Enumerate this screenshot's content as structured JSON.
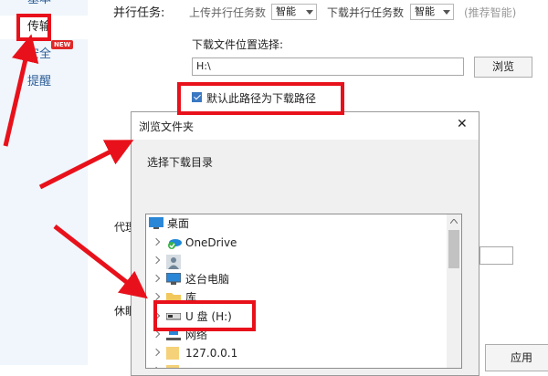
{
  "sidebar": {
    "items": [
      {
        "label": "基本"
      },
      {
        "label": "传输"
      },
      {
        "label": "安全",
        "badge": "NEW"
      },
      {
        "label": "提醒"
      }
    ]
  },
  "settings": {
    "parallel_label": "并行任务:",
    "upload_parallel_label": "上传并行任务数",
    "upload_parallel_value": "智能",
    "download_parallel_label": "下载并行任务数",
    "download_parallel_value": "智能",
    "recommend_note": "(推荐智能)",
    "download_location_label": "下载文件位置选择:",
    "download_path_value": "H:\\",
    "browse_button": "浏览",
    "default_path_checkbox_label": "默认此路径为下载路径",
    "default_path_checked": true,
    "proxy_label_partial": "代理",
    "rest_label_partial": "休眠",
    "apply_button": "应用"
  },
  "dialog": {
    "title": "浏览文件夹",
    "close_glyph": "✕",
    "instruction": "选择下载目录",
    "tree": [
      {
        "label": "桌面",
        "icon": "desktop-icon",
        "expandable": false
      },
      {
        "label": "OneDrive",
        "icon": "onedrive-icon",
        "expandable": true
      },
      {
        "label": "",
        "icon": "user-icon",
        "expandable": true
      },
      {
        "label": "这台电脑",
        "icon": "computer-icon",
        "expandable": true
      },
      {
        "label": "库",
        "icon": "library-folder-icon",
        "expandable": true
      },
      {
        "label": "U 盘 (H:)",
        "icon": "usb-drive-icon",
        "expandable": true
      },
      {
        "label": "网络",
        "icon": "network-icon",
        "expandable": true
      },
      {
        "label": "127.0.0.1",
        "icon": "folder-icon",
        "expandable": true
      },
      {
        "label": "",
        "icon": "folder-icon",
        "expandable": true
      }
    ]
  },
  "annotation_color": "#e8111b",
  "accent_color": "#3a78c2"
}
